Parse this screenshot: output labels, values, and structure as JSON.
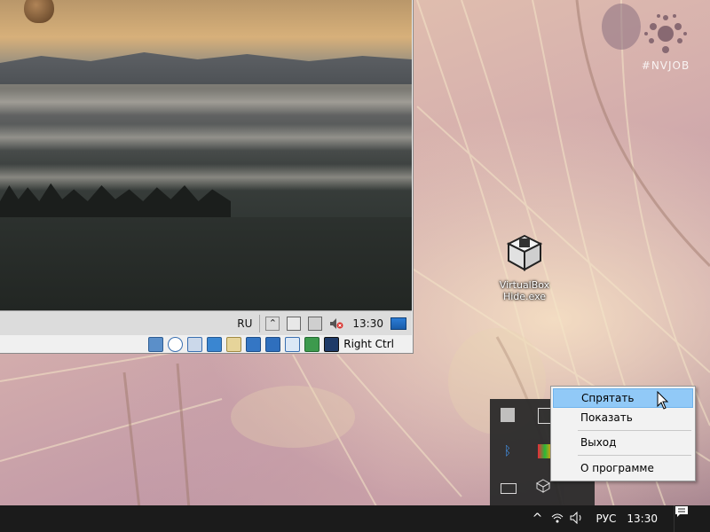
{
  "vm": {
    "guest_lang": "RU",
    "guest_time": "13:30",
    "host_key": "Right Ctrl"
  },
  "desktop": {
    "icon_label_line1": "VirtualBox",
    "icon_label_line2": "Hide.exe",
    "watermark": "#NVJOB"
  },
  "context_menu": {
    "items": [
      "Спрятать",
      "Показать",
      "Выход",
      "О программе"
    ]
  },
  "taskbar": {
    "lang": "РУС",
    "time": "13:30"
  },
  "colors": {
    "menu_highlight": "#91c9f7",
    "taskbar": "#1b1b1b",
    "tray_overflow": "#2b2b2b"
  }
}
